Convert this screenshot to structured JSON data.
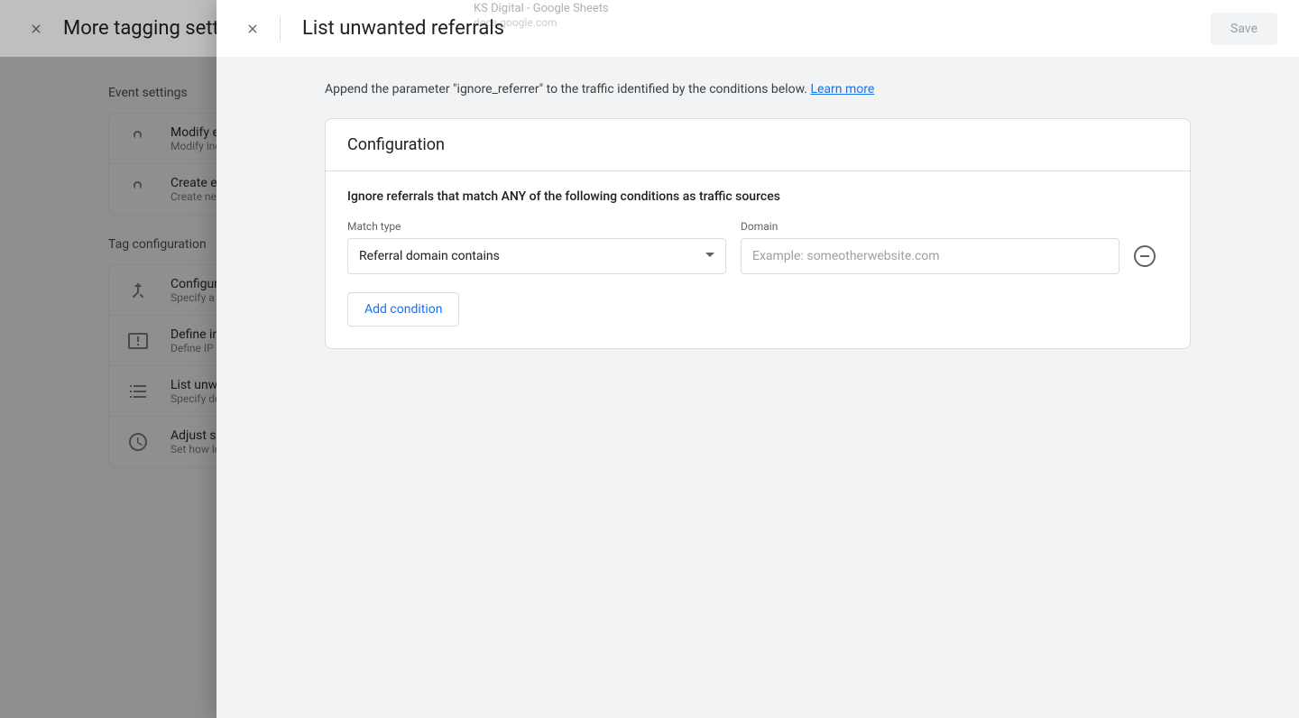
{
  "ghost": {
    "title": "KS Digital - Google Sheets",
    "sub": "docs.google.com"
  },
  "background": {
    "title": "More tagging settings",
    "section1": "Event settings",
    "items1": [
      {
        "title": "Modify events",
        "sub": "Modify incoming events"
      },
      {
        "title": "Create events",
        "sub": "Create new events"
      }
    ],
    "section2": "Tag configuration",
    "items2": [
      {
        "title": "Configure your domains",
        "sub": "Specify a list of domains"
      },
      {
        "title": "Define internal traffic",
        "sub": "Define IP addresses"
      },
      {
        "title": "List unwanted referrals",
        "sub": "Specify domains"
      },
      {
        "title": "Adjust session timeout",
        "sub": "Set how long"
      }
    ]
  },
  "foreground": {
    "title": "List unwanted referrals",
    "save": "Save",
    "description": "Append the parameter \"ignore_referrer\" to the traffic identified by the conditions below. ",
    "learn_more": "Learn more",
    "config_header": "Configuration",
    "config_subtitle": "Ignore referrals that match ANY of the following conditions as traffic sources",
    "match_type_label": "Match type",
    "match_type_value": "Referral domain contains",
    "domain_label": "Domain",
    "domain_placeholder": "Example: someotherwebsite.com",
    "add_condition": "Add condition"
  }
}
